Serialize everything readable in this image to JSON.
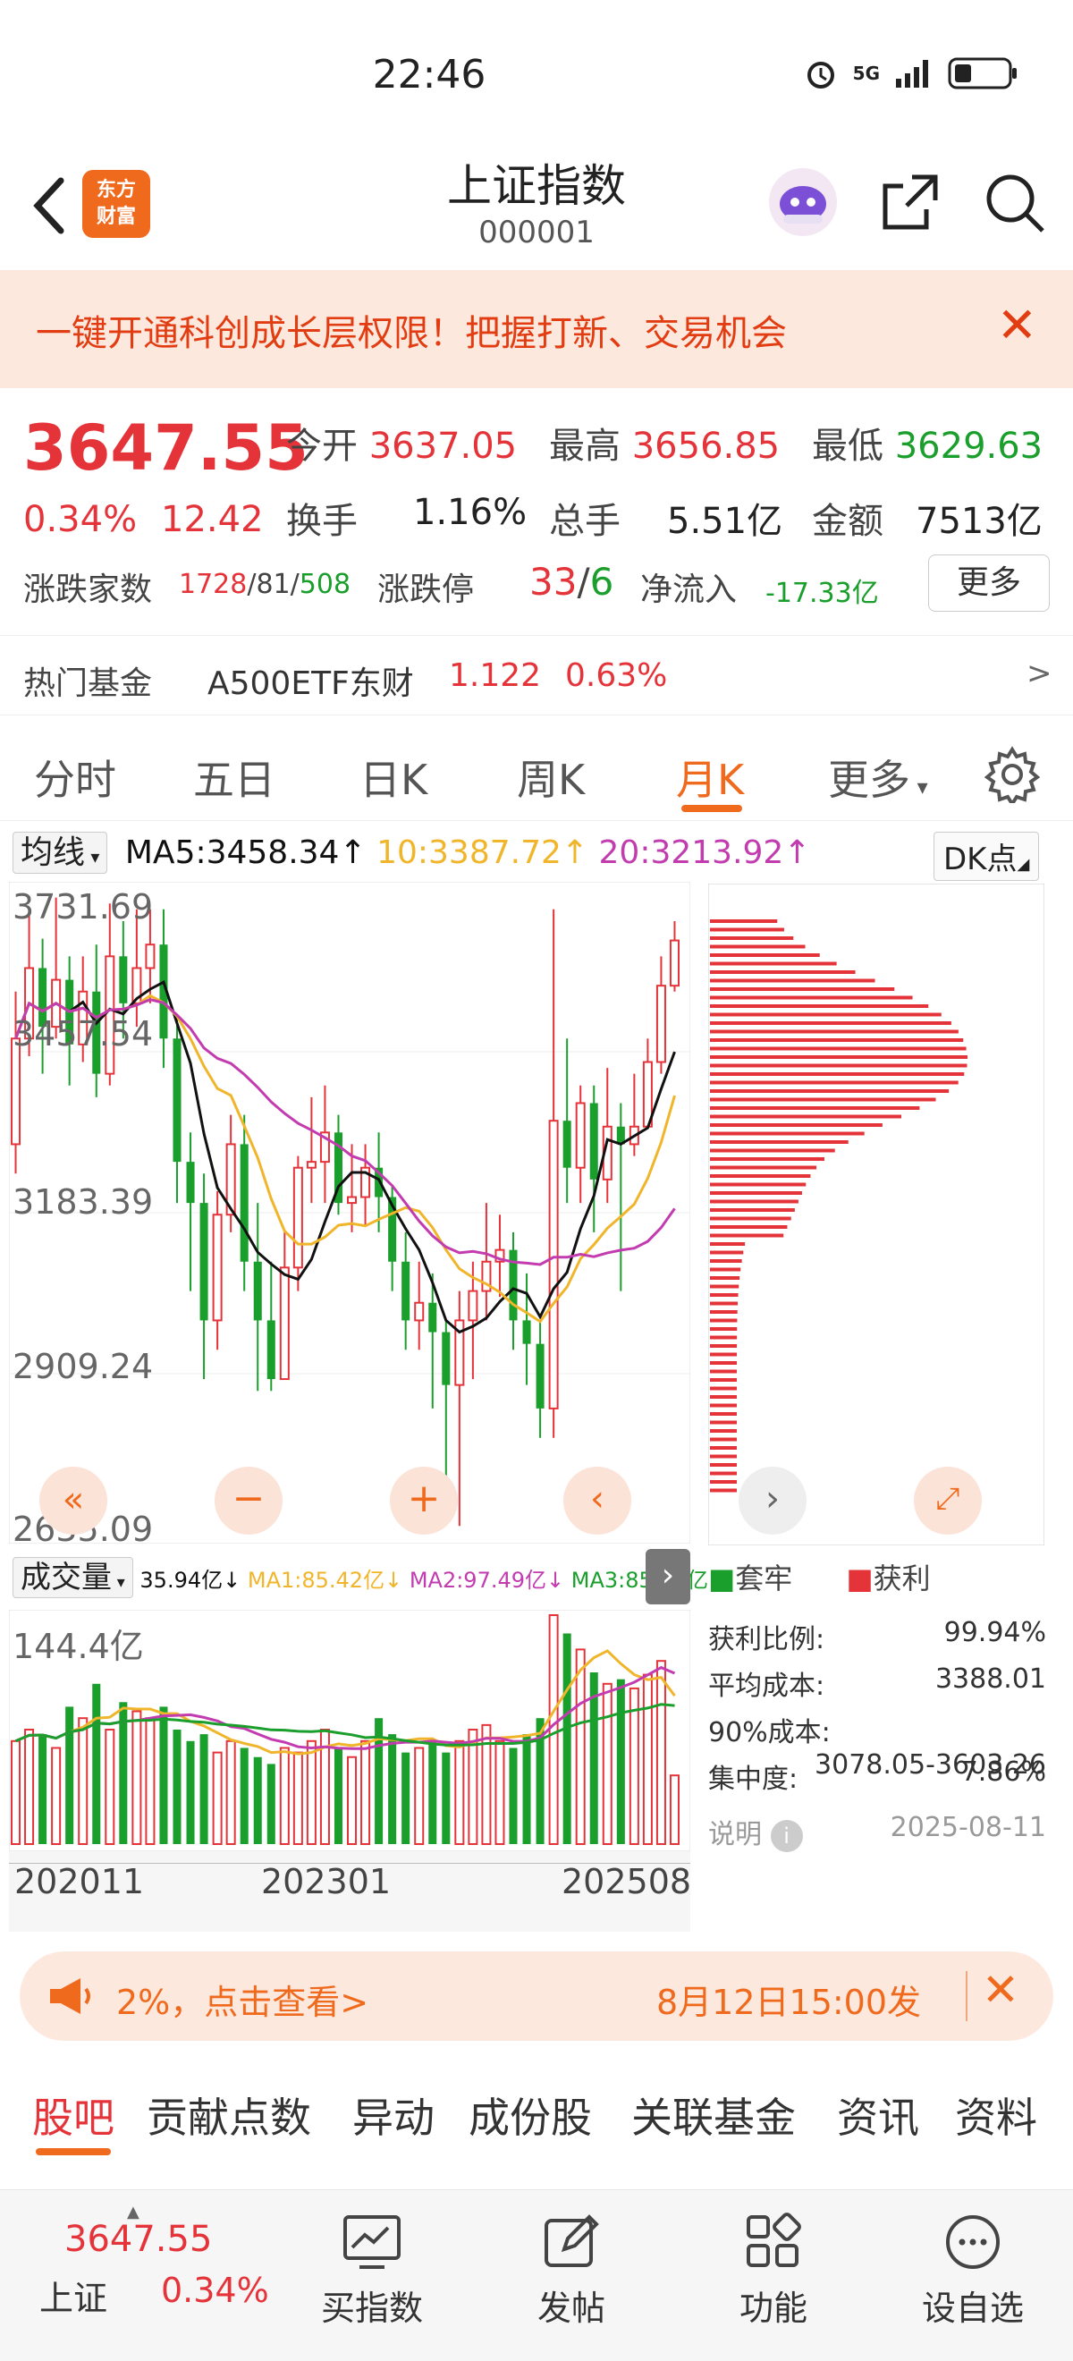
{
  "status": {
    "time": "22:46",
    "network": "5G"
  },
  "nav": {
    "title": "上证指数",
    "code": "000001",
    "logo_line1": "东方",
    "logo_line2": "财富"
  },
  "banner": {
    "text": "一键开通科创成长层权限！把握打新、交易机会"
  },
  "quote": {
    "price": "3647.55",
    "pct": "0.34%",
    "change": "12.42",
    "open_label": "今开",
    "open": "3637.05",
    "high_label": "最高",
    "high": "3656.85",
    "low_label": "最低",
    "low": "3629.63",
    "turnover_label": "换手",
    "turnover": "1.16%",
    "volume_label": "总手",
    "volume": "5.51亿",
    "amount_label": "金额",
    "amount": "7513亿",
    "updown_label": "涨跌家数",
    "up": "1728",
    "flat": "81",
    "down": "508",
    "limit_label": "涨跌停",
    "limit_up": "33",
    "limit_down": "6",
    "inflow_label": "净流入",
    "inflow": "-17.33亿",
    "more": "更多"
  },
  "hotfund": {
    "label": "热门基金",
    "name": "A500ETF东财",
    "price": "1.122",
    "pct": "0.63%",
    "arrow": ">"
  },
  "tabs": [
    "分时",
    "五日",
    "日K",
    "周K",
    "月K",
    "更多"
  ],
  "ma": {
    "select": "均线",
    "ma5": "MA5:3458.34↑",
    "ma10": "10:3387.72↑",
    "ma20": "20:3213.92↑",
    "dk": "DK点"
  },
  "price_axis": [
    "3731.69",
    "3457.54",
    "3183.39",
    "2909.24",
    "2635.09"
  ],
  "vol": {
    "select": "成交量",
    "v": "35.94亿↓",
    "ma1": "MA1:85.42亿↓",
    "ma2": "MA2:97.49亿↓",
    "ma3": "MA3:85.57亿↓",
    "max": "144.4亿"
  },
  "dates": [
    "202011",
    "202301",
    "202508"
  ],
  "profile": {
    "trapped": "套牢",
    "profit": "获利",
    "rows": [
      {
        "k": "获利比例:",
        "v": "99.94%"
      },
      {
        "k": "平均成本:",
        "v": "3388.01"
      },
      {
        "k": "90%成本:",
        "v": "3078.05-3603.26"
      },
      {
        "k": "集中度:",
        "v": "7.86%"
      }
    ],
    "note": "说明",
    "date": "2025-08-11"
  },
  "notice": {
    "text": "2%，点击查看>",
    "time": "8月12日15:00发"
  },
  "bottom_tabs": [
    "股吧",
    "贡献点数",
    "异动",
    "成份股",
    "关联基金",
    "资讯",
    "资料"
  ],
  "footer": {
    "price": "3647.55",
    "name": "上证",
    "pct": "0.34%",
    "buy": "买指数",
    "post": "发帖",
    "func": "功能",
    "fav": "设自选"
  },
  "colors": {
    "up": "#e5333a",
    "down": "#1a9e2c",
    "accent": "#f06a1e",
    "ma5": "#111111",
    "ma10": "#f0b52a",
    "ma20": "#c23cb0"
  },
  "chart_data": {
    "type": "candlestick",
    "period": "monthly",
    "ma": {
      "MA5": 3458.34,
      "MA10": 3387.72,
      "MA20": 3213.92
    },
    "y_range": [
      2635.09,
      3731.69
    ],
    "bars": [
      [
        3300,
        3480,
        3560,
        3250
      ],
      [
        3480,
        3600,
        3700,
        3450
      ],
      [
        3600,
        3500,
        3650,
        3420
      ],
      [
        3500,
        3580,
        3720,
        3480
      ],
      [
        3580,
        3470,
        3620,
        3400
      ],
      [
        3470,
        3560,
        3620,
        3440
      ],
      [
        3560,
        3420,
        3640,
        3380
      ],
      [
        3420,
        3620,
        3710,
        3400
      ],
      [
        3620,
        3540,
        3680,
        3480
      ],
      [
        3540,
        3600,
        3700,
        3500
      ],
      [
        3600,
        3640,
        3700,
        3540
      ],
      [
        3640,
        3480,
        3700,
        3430
      ],
      [
        3480,
        3270,
        3520,
        3200
      ],
      [
        3270,
        3200,
        3320,
        3050
      ],
      [
        3200,
        3000,
        3250,
        2900
      ],
      [
        3000,
        3180,
        3220,
        2950
      ],
      [
        3180,
        3300,
        3350,
        3150
      ],
      [
        3300,
        3100,
        3350,
        3050
      ],
      [
        3100,
        3000,
        3200,
        2880
      ],
      [
        3000,
        2900,
        3100,
        2880
      ],
      [
        2900,
        3090,
        3150,
        2900
      ],
      [
        3090,
        3260,
        3280,
        3050
      ],
      [
        3260,
        3270,
        3380,
        3200
      ],
      [
        3270,
        3320,
        3400,
        3200
      ],
      [
        3320,
        3200,
        3350,
        3180
      ],
      [
        3200,
        3210,
        3300,
        3150
      ],
      [
        3210,
        3260,
        3300,
        3160
      ],
      [
        3260,
        3210,
        3320,
        3150
      ],
      [
        3210,
        3100,
        3230,
        3050
      ],
      [
        3100,
        3000,
        3150,
        2950
      ],
      [
        3000,
        3030,
        3100,
        2950
      ],
      [
        3030,
        2980,
        3080,
        2850
      ],
      [
        2980,
        2890,
        3000,
        2700
      ],
      [
        2890,
        3000,
        3050,
        2650
      ],
      [
        3000,
        3050,
        3100,
        2900
      ],
      [
        3050,
        3100,
        3200,
        3000
      ],
      [
        3100,
        3120,
        3180,
        3040
      ],
      [
        3120,
        3000,
        3150,
        2950
      ],
      [
        3000,
        2960,
        3080,
        2890
      ],
      [
        2960,
        2850,
        3000,
        2800
      ],
      [
        2850,
        3340,
        3700,
        2800
      ],
      [
        3340,
        3260,
        3480,
        3200
      ],
      [
        3260,
        3370,
        3400,
        3200
      ],
      [
        3370,
        3240,
        3400,
        3150
      ],
      [
        3240,
        3330,
        3430,
        3200
      ],
      [
        3330,
        3300,
        3370,
        3050
      ],
      [
        3300,
        3330,
        3420,
        3280
      ],
      [
        3330,
        3440,
        3480,
        3330
      ],
      [
        3440,
        3570,
        3620,
        3420
      ],
      [
        3570,
        3647,
        3680,
        3560
      ]
    ],
    "volume_max_label": "144.4亿",
    "volume": [
      0.45,
      0.5,
      0.48,
      0.42,
      0.6,
      0.55,
      0.7,
      0.5,
      0.62,
      0.58,
      0.55,
      0.6,
      0.5,
      0.45,
      0.48,
      0.4,
      0.45,
      0.42,
      0.38,
      0.35,
      0.42,
      0.4,
      0.45,
      0.5,
      0.42,
      0.38,
      0.45,
      0.55,
      0.48,
      0.4,
      0.42,
      0.45,
      0.4,
      0.45,
      0.5,
      0.52,
      0.45,
      0.42,
      0.48,
      0.55,
      1.0,
      0.92,
      0.85,
      0.75,
      0.7,
      0.72,
      0.68,
      0.74,
      0.8,
      0.3
    ]
  }
}
